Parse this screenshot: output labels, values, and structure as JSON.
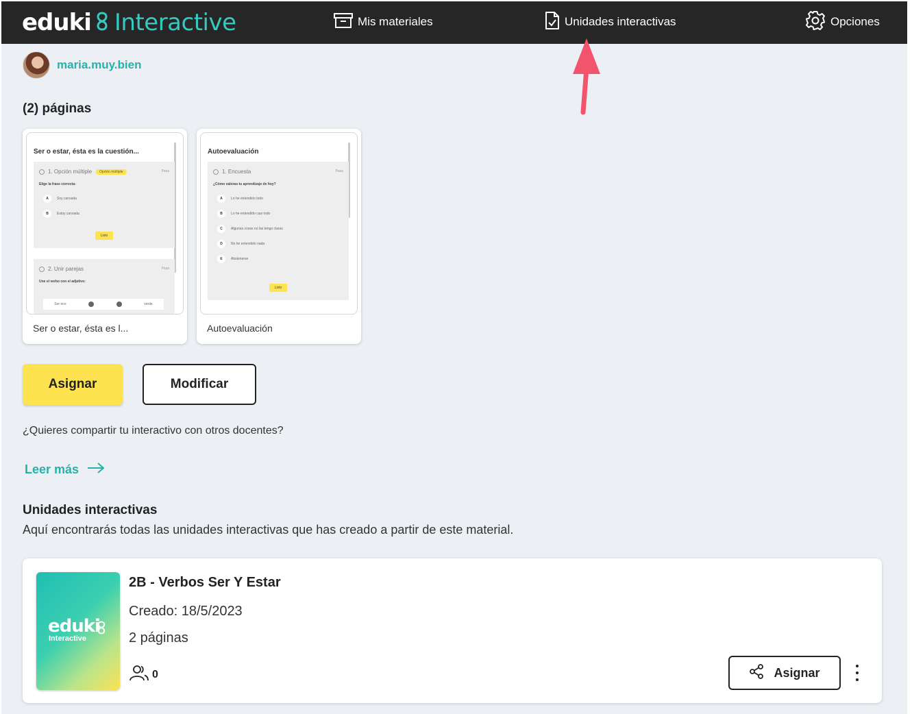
{
  "nav": {
    "logo_word": "eduki",
    "logo_sub": "Interactive",
    "items": [
      {
        "label": "Mis materiales",
        "icon": "archive-box-icon"
      },
      {
        "label": "Unidades interactivas",
        "icon": "document-check-icon"
      },
      {
        "label": "Opciones",
        "icon": "gear-icon"
      }
    ]
  },
  "user": {
    "name": "maria.muy.bien"
  },
  "pages": {
    "count_label": "(2) páginas",
    "thumbnails": [
      {
        "title": "Ser o estar, ésta es la cuestión...",
        "label": "Ser o estar, ésta es l...",
        "q1_head": "1. Opción múltiple",
        "q1_tag": "Opción múltiple",
        "q1_right": "Pasa",
        "q1_question": "Elige la frase correcta:",
        "q1_options": [
          {
            "letter": "A",
            "text": "Soy cansada"
          },
          {
            "letter": "B",
            "text": "Estoy cansada"
          }
        ],
        "q1_button": "Listo",
        "q2_head": "2. Unir parejas",
        "q2_right": "Pasa",
        "q2_question": "Une el verbo con el adjetivo:",
        "q2_left": "Ser rico",
        "q2_right_word": "verde"
      },
      {
        "title": "Autoevaluación",
        "label": "Autoevaluación",
        "q1_head": "1. Encuesta",
        "q1_right": "Pasa",
        "q1_question": "¿Cómo valoras tu aprendizaje de hoy?",
        "q1_options": [
          {
            "letter": "A",
            "text": "Lo he entendido todo"
          },
          {
            "letter": "B",
            "text": "Lo he entendido casi todo"
          },
          {
            "letter": "C",
            "text": "Algunas cosas no las tengo claras"
          },
          {
            "letter": "D",
            "text": "No he entendido nada"
          },
          {
            "letter": "E",
            "text": "Abstenerse"
          }
        ],
        "q1_button": "Listo"
      }
    ]
  },
  "actions": {
    "assign_label": "Asignar",
    "modify_label": "Modificar",
    "share_question": "¿Quieres compartir tu interactivo con otros docentes?",
    "read_more": "Leer más"
  },
  "units": {
    "title": "Unidades interactivas",
    "description": "Aquí encontrarás todas las unidades interactivas que has creado a partir de este material.",
    "items": [
      {
        "cover_word": "eduki",
        "cover_sub": "Interactive",
        "title": "2B - Verbos Ser Y Estar",
        "created": "Creado: 18/5/2023",
        "pages": "2 páginas",
        "students": "0",
        "assign_label": "Asignar"
      }
    ]
  },
  "colors": {
    "nav_bg": "#262626",
    "accent_teal": "#27b2a9",
    "accent_yellow": "#fce34f",
    "page_bg": "#eceff3",
    "annotation_arrow": "#f2546d"
  }
}
